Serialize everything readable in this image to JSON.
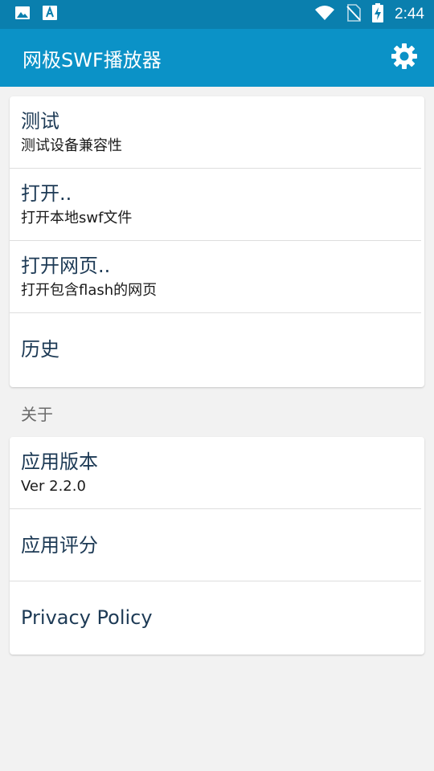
{
  "status_bar": {
    "time": "2:44",
    "icons": [
      "image-icon",
      "text-a-icon",
      "wifi-icon",
      "no-sim-icon",
      "battery-charging-icon"
    ]
  },
  "app_bar": {
    "title": "网极SWF播放器",
    "settings_icon": "gear-icon"
  },
  "colors": {
    "status_bar": "#0a7fae",
    "app_bar": "#0b92c7",
    "item_title": "#1d3a55",
    "background": "#f2f2f2"
  },
  "main_menu": {
    "items": [
      {
        "title": "测试",
        "subtitle": "测试设备兼容性"
      },
      {
        "title": "打开..",
        "subtitle": "打开本地swf文件"
      },
      {
        "title": "打开网页..",
        "subtitle": "打开包含flash的网页"
      },
      {
        "title": "历史"
      }
    ]
  },
  "about": {
    "label": "关于",
    "items": [
      {
        "title": "应用版本",
        "subtitle": "Ver 2.2.0"
      },
      {
        "title": "应用评分"
      },
      {
        "title": "Privacy Policy"
      }
    ]
  }
}
